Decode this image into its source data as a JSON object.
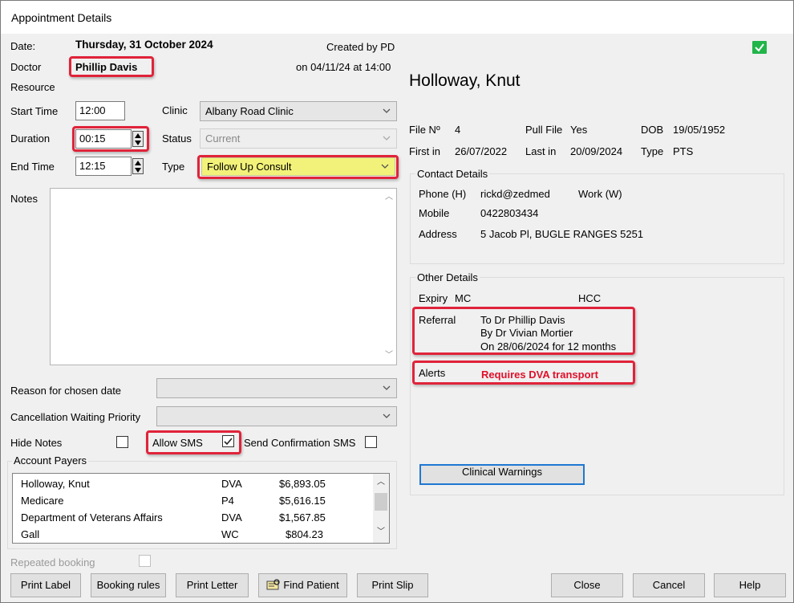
{
  "window": {
    "title": "Appointment Details"
  },
  "appointment": {
    "date_label": "Date:",
    "date_value": "Thursday, 31 October 2024",
    "doctor_label": "Doctor",
    "doctor_value": "Phillip Davis",
    "resource_label": "Resource",
    "created_by": "Created by PD",
    "created_on": "on 04/11/24 at 14:00",
    "start_time_label": "Start Time",
    "start_time_value": "12:00",
    "duration_label": "Duration",
    "duration_value": "00:15",
    "end_time_label": "End Time",
    "end_time_value": "12:15",
    "clinic_label": "Clinic",
    "clinic_value": "Albany Road Clinic",
    "status_label": "Status",
    "status_value": "Current",
    "type_label": "Type",
    "type_value": "Follow Up Consult",
    "notes_label": "Notes",
    "reason_label": "Reason for chosen date",
    "cancellation_label": "Cancellation Waiting Priority",
    "hide_notes_label": "Hide Notes",
    "hide_notes_checked": false,
    "allow_sms_label": "Allow SMS",
    "allow_sms_checked": true,
    "send_conf_label": "Send Confirmation SMS",
    "send_conf_checked": false,
    "repeated_label": "Repeated booking"
  },
  "account_payers": {
    "title": "Account Payers",
    "rows": [
      {
        "name": "Holloway, Knut",
        "code": "DVA",
        "amount": "$6,893.05"
      },
      {
        "name": "Medicare",
        "code": "P4",
        "amount": "$5,616.15"
      },
      {
        "name": "Department of Veterans Affairs",
        "code": "DVA",
        "amount": "$1,567.85"
      },
      {
        "name": "Gall",
        "code": "WC",
        "amount": "$804.23"
      }
    ]
  },
  "patient": {
    "name": "Holloway, Knut",
    "file_no_label": "File Nº",
    "file_no": "4",
    "pull_file_label": "Pull File",
    "pull_file": "Yes",
    "dob_label": "DOB",
    "dob": "19/05/1952",
    "first_in_label": "First in",
    "first_in": "26/07/2022",
    "last_in_label": "Last in",
    "last_in": "20/09/2024",
    "type_label": "Type",
    "type": "PTS"
  },
  "contact": {
    "title": "Contact Details",
    "phone_label": "Phone (H)",
    "phone": "rickd@zedmed",
    "work_label": "Work (W)",
    "mobile_label": "Mobile",
    "mobile": "0422803434",
    "address_label": "Address",
    "address": "5 Jacob Pl,  BUGLE RANGES 5251"
  },
  "other": {
    "title": "Other Details",
    "expiry_label": "Expiry",
    "mc_label": "MC",
    "hcc_label": "HCC",
    "referral_label": "Referral",
    "referral_line1": "To Dr Phillip Davis",
    "referral_line2": "By Dr Vivian Mortier",
    "referral_line3": "On 28/06/2024 for  12 months",
    "alerts_label": "Alerts",
    "alerts_value": "Requires DVA transport"
  },
  "buttons": {
    "clinical_warnings": "Clinical Warnings",
    "print_label": "Print Label",
    "booking_rules": "Booking rules",
    "print_letter": "Print Letter",
    "find_patient": "Find Patient",
    "print_slip": "Print Slip",
    "close": "Close",
    "cancel": "Cancel",
    "help": "Help"
  },
  "colors": {
    "highlight": "#e0233a",
    "type_bg": "#f2f27a",
    "alert_text": "#e0102a",
    "status_icon": "#21b54a"
  },
  "icons": {
    "status": "check-icon",
    "find_patient": "find-patient-icon"
  }
}
